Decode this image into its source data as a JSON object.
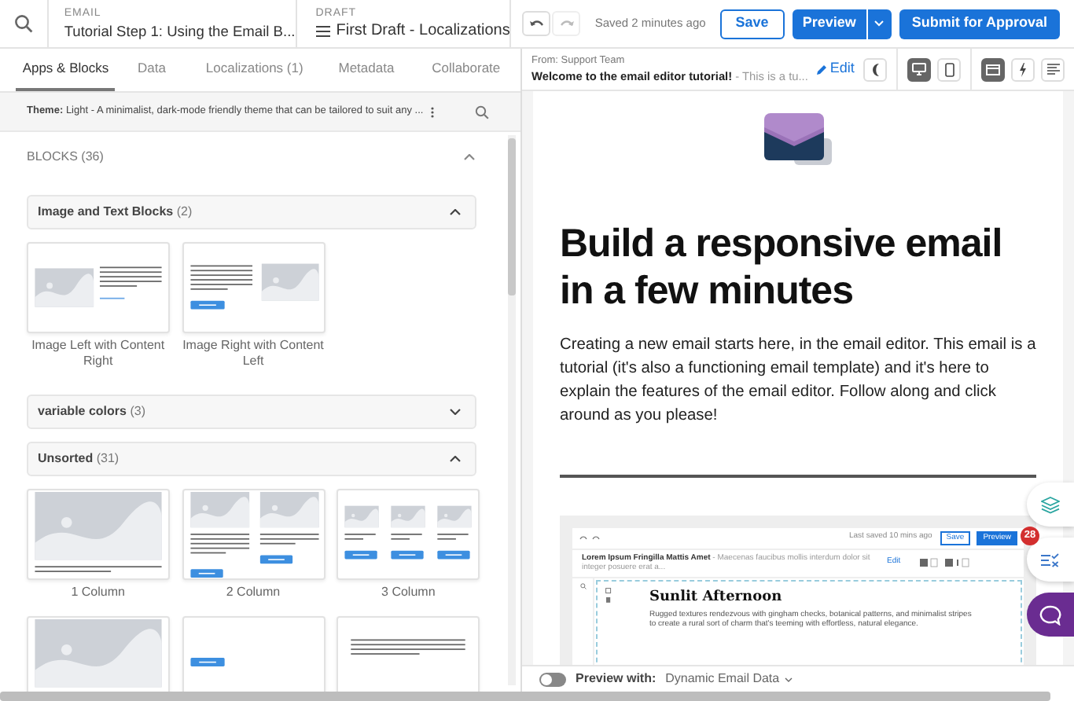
{
  "top_bar": {
    "email_label": "EMAIL",
    "email_title": "Tutorial Step 1: Using the Email B...",
    "draft_label": "DRAFT",
    "draft_title": "First Draft - Localizations",
    "saved_status": "Saved 2 minutes ago",
    "save_label": "Save",
    "preview_label": "Preview",
    "submit_label": "Submit for Approval"
  },
  "tabs": [
    {
      "label": "Apps & Blocks",
      "selected": true
    },
    {
      "label": "Data",
      "selected": false
    },
    {
      "label": "Localizations (1)",
      "selected": false
    },
    {
      "label": "Metadata",
      "selected": false
    },
    {
      "label": "Collaborate",
      "selected": false
    }
  ],
  "theme": {
    "label": "Theme:",
    "value": "Light - A minimalist, dark-mode friendly theme that can be tailored to suit any ..."
  },
  "blocks": {
    "title": "BLOCKS (36)",
    "expanded": true,
    "groups": [
      {
        "name": "Image and Text Blocks",
        "count": "(2)",
        "expanded": true,
        "items": [
          {
            "label": "Image Left with Content Right",
            "kind": "image-left"
          },
          {
            "label": "Image Right with Content Left",
            "kind": "image-right"
          }
        ]
      },
      {
        "name": "variable colors",
        "count": "(3)",
        "expanded": false
      },
      {
        "name": "Unsorted",
        "count": "(31)",
        "expanded": true,
        "items": [
          {
            "label": "1 Column",
            "kind": "one-column"
          },
          {
            "label": "2 Column",
            "kind": "two-column"
          },
          {
            "label": "3 Column",
            "kind": "three-column"
          },
          {
            "kind": "image-full"
          },
          {
            "kind": "button-only"
          },
          {
            "kind": "text-only"
          }
        ]
      }
    ]
  },
  "preview": {
    "from": "From: Support Team",
    "subject": "Welcome to the email editor tutorial!",
    "preheader": "- This is a tu...",
    "edit_label": "Edit",
    "dark_mode": false,
    "devices": [
      {
        "kind": "desktop",
        "selected": true
      },
      {
        "kind": "mobile",
        "selected": false
      }
    ],
    "views": [
      {
        "kind": "layout",
        "selected": true
      },
      {
        "kind": "bolt",
        "selected": false
      },
      {
        "kind": "text",
        "selected": false
      }
    ]
  },
  "email": {
    "heading": "Build a responsive email in a few minutes",
    "body": "Creating a new email starts here, in the email editor. This email is a tutorial (it's also a functioning email template) and it's here to explain the features of the email editor. Follow along and click around as you please!",
    "embedded": {
      "saved": "Last saved 10 mins ago",
      "save": "Save",
      "preview": "Preview",
      "subject": "Lorem Ipsum Fringilla Mattis Amet",
      "preheader": "- Maecenas faucibus mollis interdum dolor sit integer posuere erat a...",
      "edit": "Edit",
      "title": "Sunlit Afternoon",
      "text": "Rugged textures rendezvous with gingham checks, botanical patterns, and minimalist stripes to create a rural sort of charm that's teeming with effortless, natural elegance."
    }
  },
  "side_tools": {
    "checklist_badge": "28"
  },
  "footer": {
    "preview_toggle": false,
    "label": "Preview with:",
    "value": "Dynamic Email Data"
  }
}
